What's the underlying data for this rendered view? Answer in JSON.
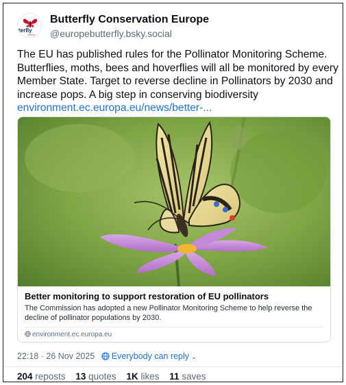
{
  "post": {
    "author": {
      "display_name": "Butterfly Conservation Europe",
      "handle": "@europebutterfly.bsky.social",
      "avatar_text": "terfly",
      "avatar_icon": "butterfly-logo-icon"
    },
    "text_lines": [
      "The EU has published rules for the Pollinator Monitoring Scheme.",
      "Butterflies, moths, bees and hoverflies will all be monitored by every",
      "Member State. Target to reverse decline in Pollinators by 2030 and",
      "increase pops. A big step in conserving biodiversity"
    ],
    "link_text": "environment.ec.europa.eu/news/better-...",
    "card": {
      "image_icon": "swallowtail-butterfly-on-cosmos-photo",
      "title": "Better monitoring to support restoration of EU pollinators",
      "description": "The Commission has adopted a new Pollinator Monitoring Scheme to help reverse the decline of pollinator populations by 2030.",
      "domain": "environment.ec.europa.eu",
      "domain_icon": "globe-icon"
    },
    "timestamp": "22:18 · 26 Nov 2025",
    "reply_setting": "Everybody can reply",
    "reply_icon": "globe-icon",
    "stats": {
      "reposts_count": "204",
      "reposts_label": "reposts",
      "quotes_count": "13",
      "quotes_label": "quotes",
      "likes_count": "1K",
      "likes_label": "likes",
      "saves_count": "11",
      "saves_label": "saves"
    }
  },
  "colors": {
    "link": "#1a73e8",
    "muted": "#5b6b7b",
    "text": "#0b0f14",
    "brand_red": "#c8102e"
  }
}
